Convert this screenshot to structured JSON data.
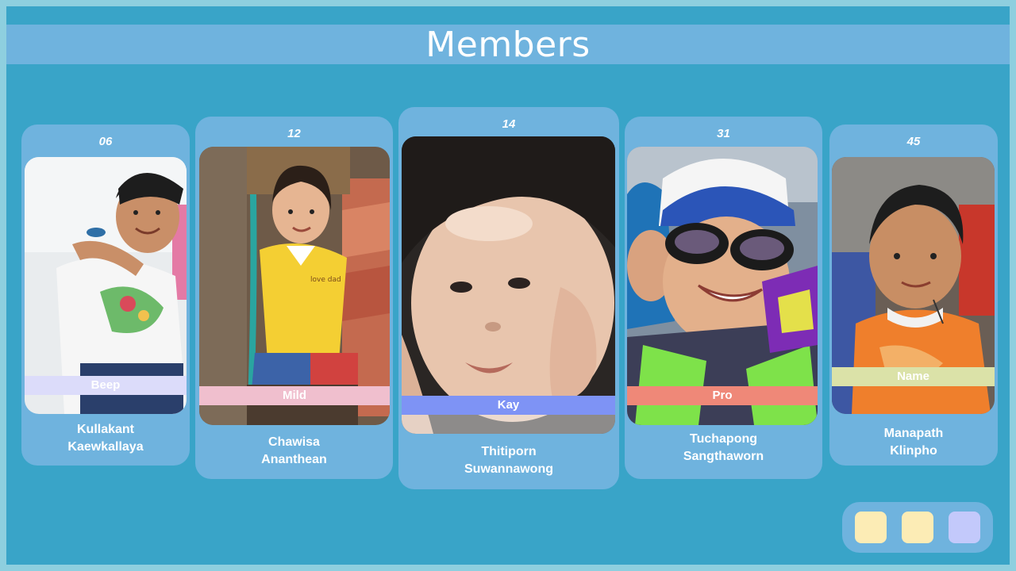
{
  "header": {
    "title": "Members"
  },
  "members": [
    {
      "number": "06",
      "nickname": "Beep",
      "first_name": "Kullakant",
      "last_name": "Kaewkallaya",
      "tag_color": "#dcdcfa"
    },
    {
      "number": "12",
      "nickname": "Mild",
      "first_name": "Chawisa",
      "last_name": "Ananthean",
      "tag_color": "#f0bfce"
    },
    {
      "number": "14",
      "nickname": "Kay",
      "first_name": "Thitiporn",
      "last_name": "Suwannawong",
      "tag_color": "#7e93f5"
    },
    {
      "number": "31",
      "nickname": "Pro",
      "first_name": "Tuchapong",
      "last_name": "Sangthaworn",
      "tag_color": "#ef8878"
    },
    {
      "number": "45",
      "nickname": "Name",
      "first_name": "Manapath",
      "last_name": "Klinpho",
      "tag_color": "#dbe2a8"
    }
  ],
  "pager": {
    "dots": [
      {
        "color": "#fcecb5"
      },
      {
        "color": "#fcecb5"
      },
      {
        "color": "#c3c9fb"
      }
    ]
  }
}
